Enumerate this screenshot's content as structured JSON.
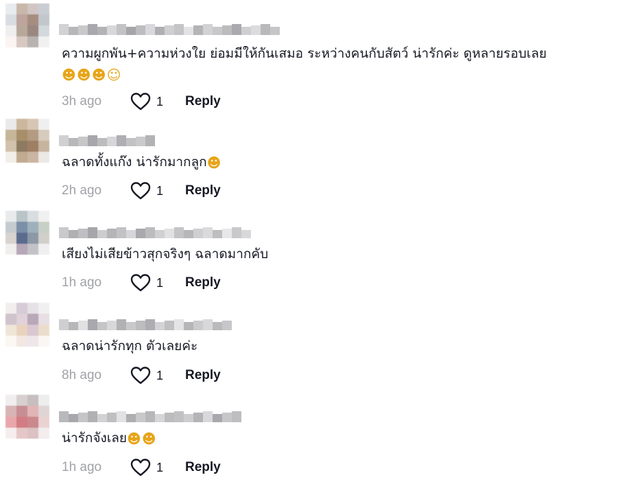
{
  "comments": [
    {
      "text": "ความผูกพัน+ความห่วงใย ย่อมมีให้กันเสมอ ระหว่างคนกับสัตว์ น่ารักค่ะ ดูหลายรอบเลย",
      "emojis": [
        "smiling-face-with-hearts",
        "smiling-face-with-hearts",
        "smiling-face-with-hearts",
        "grinning-face"
      ],
      "time": "3h ago",
      "likes": "1",
      "reply_label": "Reply",
      "avatar_colors": [
        "#e9ecef",
        "#c9b7aa",
        "#d1c6c3",
        "#c8cdd3",
        "#d9dde2",
        "#bda59d",
        "#a58e80",
        "#c1c7cb",
        "#efefef",
        "#b8a89c",
        "#9a8780",
        "#d3d8dc",
        "#fbf4f2",
        "#d7c8c1",
        "#b8b2b1",
        "#f0f0f0"
      ],
      "username_colors": [
        "#d2d2d4",
        "#b7b7ba",
        "#c9c9cb",
        "#a9a9ad",
        "#b3b3b6",
        "#d8d8da",
        "#c3c3c6",
        "#a6a6aa",
        "#bdbdc0",
        "#d9d9db",
        "#b0b0b4",
        "#cfcfd1",
        "#c5c5c8",
        "#e3e3e5",
        "#b4b4b7",
        "#d2d2d4",
        "#c8c8cb",
        "#bcbcbf",
        "#aaaaae",
        "#cfcfd2",
        "#dcdcde",
        "#b9b9bc",
        "#c6c6c9"
      ]
    },
    {
      "text": "ฉลาดทั้งแก๊ง น่ารักมากลูก",
      "emojis": [
        "smiling-face-with-hearts"
      ],
      "time": "2h ago",
      "likes": "1",
      "reply_label": "Reply",
      "avatar_colors": [
        "#eaeaea",
        "#cbb79b",
        "#d8c6b4",
        "#efefef",
        "#c7b59a",
        "#a78f6a",
        "#b29b80",
        "#d7cbbd",
        "#d2c2ab",
        "#8e7a60",
        "#9f7f63",
        "#c7b49f",
        "#f2efe9",
        "#c1aa8f",
        "#c9b5a2",
        "#ece8e3"
      ],
      "username_colors": [
        "#d0d0d2",
        "#b8b8bb",
        "#c7c7ca",
        "#a8a8ac",
        "#bcbcbf",
        "#d6d6d8",
        "#afafb3",
        "#c2c2c5",
        "#cacacd",
        "#b3b3b6"
      ]
    },
    {
      "text": "เสียงไม่เสียข้าวสุกจริงๆ ฉลาดมากคับ",
      "emojis": [],
      "time": "1h ago",
      "likes": "1",
      "reply_label": "Reply",
      "avatar_colors": [
        "#e8eaec",
        "#b9c4c8",
        "#d8dde0",
        "#f0f0f0",
        "#c6cbd0",
        "#7c8fa8",
        "#9eb0bb",
        "#c8d0c6",
        "#d8d3cf",
        "#5a6c8d",
        "#8d98a5",
        "#d0cfca",
        "#f1eeee",
        "#b7a7b8",
        "#c3c2c6",
        "#f0efef"
      ],
      "username_colors": [
        "#c9c9cc",
        "#b0b0b3",
        "#bfbfc2",
        "#a6a6aa",
        "#cdcdd0",
        "#b5b5b8",
        "#c2c2c5",
        "#d6d6d8",
        "#aaaaae",
        "#bcbcbf",
        "#d0d0d3",
        "#e1e1e3",
        "#c4c4c7",
        "#b7b7ba",
        "#cfcfd1",
        "#dadadc",
        "#bebec1",
        "#e7e7e9",
        "#c9c9cb",
        "#d8d8da"
      ]
    },
    {
      "text": "ฉลาดน่ารักทุก ตัวเลยค่ะ",
      "emojis": [],
      "time": "8h ago",
      "likes": "1",
      "reply_label": "Reply",
      "avatar_colors": [
        "#f2eeee",
        "#d7cbd7",
        "#e6e1e5",
        "#f1f0f0",
        "#cfc3cc",
        "#e0d2d8",
        "#b8a8b8",
        "#e7dfe3",
        "#f0e6d8",
        "#e9d3bf",
        "#d9c8d2",
        "#ecdccb",
        "#fbf7f2",
        "#f2e7e3",
        "#efe6ea",
        "#f9f6f4"
      ],
      "username_colors": [
        "#cfcfd2",
        "#b7b7ba",
        "#e1e1e3",
        "#a9a9ad",
        "#c5c5c8",
        "#d8d8da",
        "#b2b2b5",
        "#c9c9cc",
        "#bdbdc0",
        "#aeaeb2",
        "#d3d3d5",
        "#c0c0c3",
        "#e4e4e6",
        "#b6b6b9",
        "#cbcbce",
        "#d9d9db",
        "#bababd",
        "#c7c7ca"
      ]
    },
    {
      "text": "น่ารักจังเลย",
      "emojis": [
        "smiling-face-with-hearts",
        "smiling-face-with-hearts"
      ],
      "time": "1h ago",
      "likes": "1",
      "reply_label": "Reply",
      "avatar_colors": [
        "#f0eeee",
        "#d8d0d0",
        "#c7bfbf",
        "#ededed",
        "#d9b4b6",
        "#c78e93",
        "#e2b5b5",
        "#dfd5d6",
        "#e9a6ab",
        "#d27c83",
        "#c9898d",
        "#ead2d3",
        "#f6eeee",
        "#e6c7c8",
        "#dcc2c3",
        "#f3eded"
      ],
      "username_colors": [
        "#b9b9bc",
        "#a8a8ac",
        "#c5c5c8",
        "#b1b1b4",
        "#d3d3d5",
        "#bfbfc2",
        "#e2e2e4",
        "#aeaeb1",
        "#c9c9cc",
        "#b7b7ba",
        "#d6d6d8",
        "#bcbcbf",
        "#c1c1c4",
        "#cdcdd0",
        "#b4b4b7",
        "#d9d9db",
        "#a9a9ad",
        "#c7c7ca",
        "#bebec1"
      ]
    }
  ]
}
